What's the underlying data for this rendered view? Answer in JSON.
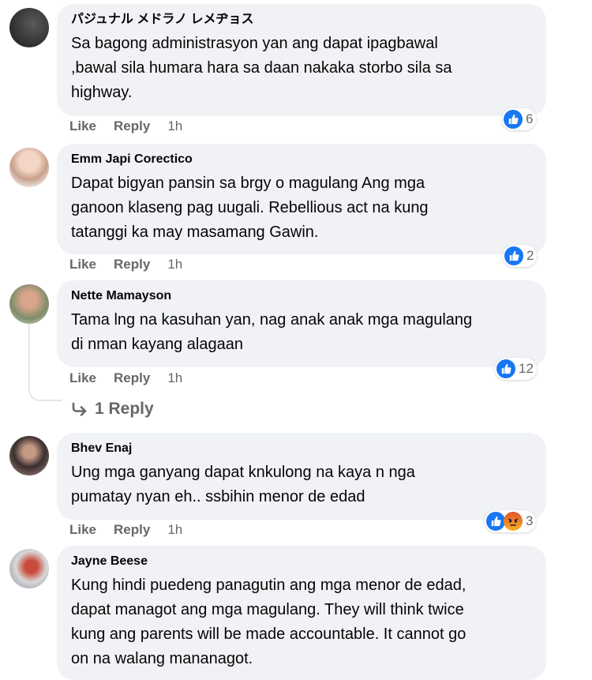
{
  "actions": {
    "like": "Like",
    "reply": "Reply"
  },
  "comments": [
    {
      "author": "パジュナル メドラノ レメヂョス",
      "lines": [
        "Sa bagong administrasyon yan ang dapat ipagbawal",
        ",bawal sila humara hara sa daan nakaka storbo sila sa",
        "highway."
      ],
      "time": "1h",
      "reactions": "6"
    },
    {
      "author": "Emm Japi Corectico",
      "lines": [
        "Dapat bigyan pansin sa brgy o magulang Ang mga",
        "ganoon klaseng pag uugali. Rebellious act na kung",
        "tatanggi ka may masamang Gawin."
      ],
      "time": "1h",
      "reactions": "2"
    },
    {
      "author": "Nette Mamayson",
      "lines": [
        "Tama lng na kasuhan yan, nag anak anak mga magulang",
        "di nman kayang alagaan"
      ],
      "time": "1h",
      "reactions": "12"
    },
    {
      "author": "Bhev Enaj",
      "lines": [
        "Ung mga ganyang dapat knkulong na kaya n nga",
        "pumatay nyan eh.. ssbihin menor de edad"
      ],
      "time": "1h",
      "reactions": "3"
    },
    {
      "author": "Jayne Beese",
      "lines": [
        "Kung hindi puedeng panagutin ang mga menor de edad,",
        "dapat managot ang mga magulang. They will think twice",
        "kung ang parents will be made accountable. It cannot go",
        "on na walang mananagot."
      ]
    }
  ],
  "replies_link": "1 Reply",
  "colors": {
    "bubble": "#f0f2f5",
    "like_blue": "#1877f2",
    "muted": "#65676b"
  }
}
